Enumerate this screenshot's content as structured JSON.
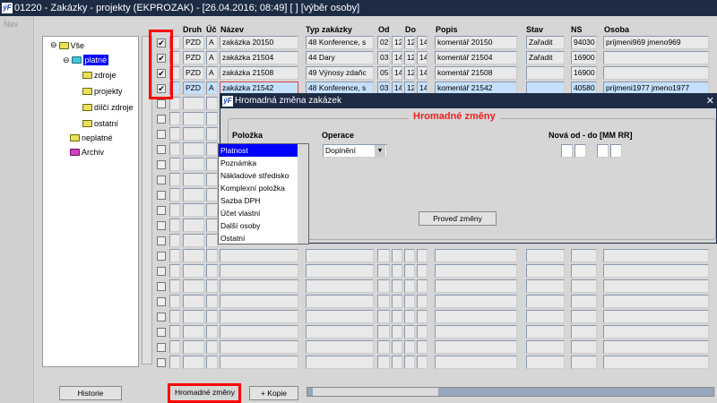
{
  "window": {
    "title": "01220 - Zakázky - projekty (EKPROZAK) - [26.04.2016; 08:49]  [ ]  [výběr osoby]",
    "logo": "ýF"
  },
  "nav": {
    "label": "Nav"
  },
  "tree": {
    "root": "Vše",
    "items": [
      {
        "label": "platné",
        "selected": true
      },
      {
        "label": "zdroje"
      },
      {
        "label": "projekty"
      },
      {
        "label": "dílčí zdroje"
      },
      {
        "label": "ostatní"
      },
      {
        "label": "neplatné"
      },
      {
        "label": "Archiv"
      }
    ]
  },
  "table": {
    "headers": {
      "druh": "Druh",
      "uc": "Úč",
      "nazev": "Název",
      "typ": "Typ zakázky",
      "od": "Od",
      "do": "Do",
      "popis": "Popis",
      "stav": "Stav",
      "ns": "NS",
      "osoba": "Osoba"
    },
    "rows": [
      {
        "checked": true,
        "druh": "PZD",
        "uc": "A",
        "nazev": "zakázka 20150",
        "typ": "48 Konference, s",
        "od1": "02",
        "od2": "12",
        "do1": "12",
        "do2": "14",
        "popis": "komentář 20150",
        "stav": "Zařadit",
        "ns": "94030",
        "osoba": "prijmeni969 jmeno969"
      },
      {
        "checked": true,
        "druh": "PZD",
        "uc": "A",
        "nazev": "zakázka 21504",
        "typ": "44 Dary",
        "od1": "03",
        "od2": "14",
        "do1": "12",
        "do2": "14",
        "popis": "komentář 21504",
        "stav": "Zařadit",
        "ns": "16900",
        "osoba": ""
      },
      {
        "checked": true,
        "druh": "PZD",
        "uc": "A",
        "nazev": "zakázka 21508",
        "typ": "49 Výnosy zdaňc",
        "od1": "05",
        "od2": "14",
        "do1": "12",
        "do2": "14",
        "popis": "komentář 21508",
        "stav": "",
        "ns": "16900",
        "osoba": ""
      },
      {
        "checked": true,
        "current": true,
        "druh": "PZD",
        "uc": "A",
        "nazev": "zakázka 21542",
        "typ": "48 Konference, s",
        "od1": "03",
        "od2": "14",
        "do1": "12",
        "do2": "14",
        "popis": "komentář 21542",
        "stav": "",
        "ns": "40580",
        "osoba": "prijmeni1977 jmeno1977"
      }
    ]
  },
  "dialog": {
    "title": "Hromadná změna zakázek",
    "section": "Hromadné změny",
    "polozka_label": "Položka",
    "operace_label": "Operace",
    "operace_value": "Doplnění",
    "nova_label": "Nová od - do [MM RR]",
    "apply_button": "Proveď změny",
    "options": [
      "Platnost",
      "Poznámka",
      "Nákladové středisko",
      "Komplexní položka",
      "Sazba DPH",
      "Účet vlastní",
      "Další osoby",
      "Ostatní"
    ],
    "selected_option": "Platnost"
  },
  "buttons": {
    "historie": "Historie",
    "hromadne": "Hromadné změny",
    "kopie": "+ Kopie"
  },
  "colors": {
    "titlebar": "#1d2b45",
    "highlight": "#f00000",
    "selection": "#0000ff"
  }
}
